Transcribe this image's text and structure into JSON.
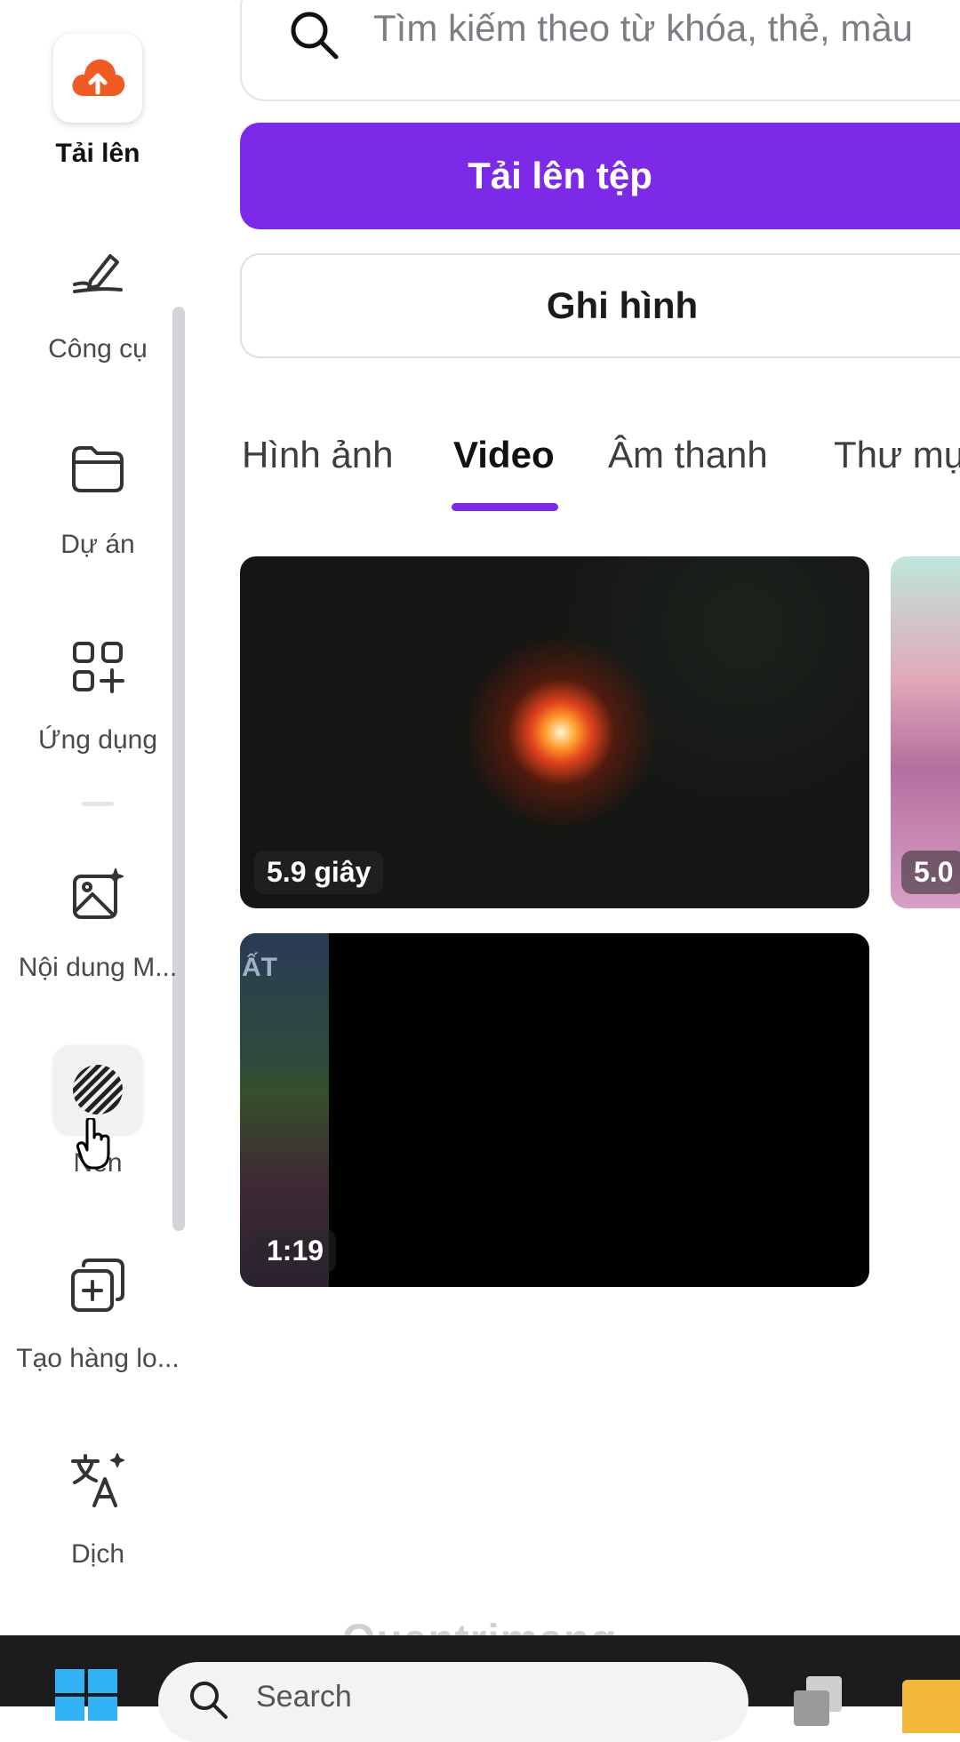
{
  "sidebar": {
    "items": [
      {
        "label": "Tải lên",
        "icon": "cloud-upload-icon",
        "active": true
      },
      {
        "label": "Công cụ",
        "icon": "pen-tool-icon"
      },
      {
        "label": "Dự án",
        "icon": "folder-icon"
      },
      {
        "label": "Ứng dụng",
        "icon": "apps-grid-icon"
      },
      {
        "label": "Nội dung M...",
        "icon": "magic-image-icon"
      },
      {
        "label": "Nền",
        "icon": "background-pattern-icon"
      },
      {
        "label": "Tạo hàng lo...",
        "icon": "bulk-create-icon"
      },
      {
        "label": "Dịch",
        "icon": "translate-icon"
      }
    ]
  },
  "search": {
    "placeholder": "Tìm kiếm theo từ khóa, thẻ, màu"
  },
  "buttons": {
    "upload": "Tải lên tệp",
    "record": "Ghi hình"
  },
  "tabs": [
    {
      "label": "Hình ảnh"
    },
    {
      "label": "Video",
      "active": true
    },
    {
      "label": "Âm thanh"
    },
    {
      "label": "Thư mụ"
    }
  ],
  "media": [
    {
      "duration": "5.9 giây"
    },
    {
      "duration": "5.0"
    },
    {
      "duration": "1:19",
      "caption": "ẤT"
    }
  ],
  "watermark": "Quantrimang",
  "taskbar": {
    "search_placeholder": "Search"
  },
  "colors": {
    "accent": "#7d2ae8",
    "upload_icon": "#f15a22"
  }
}
